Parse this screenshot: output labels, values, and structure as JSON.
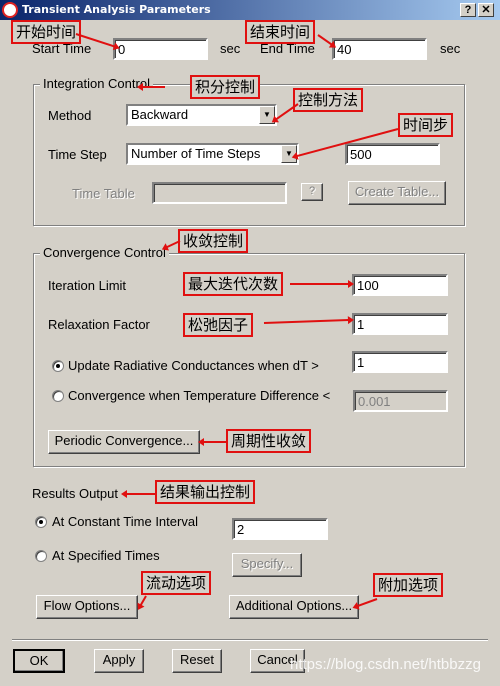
{
  "window": {
    "title": "Transient Analysis Parameters",
    "help_button": "?",
    "close_button": "✕"
  },
  "time_range": {
    "start_label": "Start Time",
    "start_value": "0",
    "start_unit": "sec",
    "end_label": "End Time",
    "end_value": "40",
    "end_unit": "sec"
  },
  "integration": {
    "group_label": "Integration Control",
    "method_label": "Method",
    "method_value": "Backward",
    "time_step_label": "Time Step",
    "time_step_mode": "Number of Time Steps",
    "time_step_value": "500",
    "time_table_label": "Time Table",
    "time_table_value": "",
    "time_table_help": "?",
    "create_table_label": "Create Table..."
  },
  "convergence": {
    "group_label": "Convergence Control",
    "iteration_limit_label": "Iteration Limit",
    "iteration_limit_value": "100",
    "relaxation_label": "Relaxation Factor",
    "relaxation_value": "1",
    "update_radiative_label": "Update Radiative Conductances when dT >",
    "update_radiative_value": "1",
    "update_radiative_checked": true,
    "temp_diff_label": "Convergence when Temperature Difference <",
    "temp_diff_value": "0.001",
    "temp_diff_checked": false,
    "periodic_button": "Periodic Convergence..."
  },
  "results": {
    "label": "Results Output",
    "constant_interval_label": "At Constant Time Interval",
    "constant_interval_value": "2",
    "constant_interval_checked": true,
    "specified_times_label": "At Specified Times",
    "specified_times_checked": false,
    "specify_button": "Specify..."
  },
  "options": {
    "flow_button": "Flow Options...",
    "additional_button": "Additional Options..."
  },
  "footer": {
    "ok": "OK",
    "apply": "Apply",
    "reset": "Reset",
    "cancel": "Cancel"
  },
  "annotations": {
    "start_time": "开始时间",
    "end_time": "结束时间",
    "integration": "积分控制",
    "method": "控制方法",
    "time_step": "时间步",
    "convergence": "收敛控制",
    "iteration_limit": "最大迭代次数",
    "relaxation": "松弛因子",
    "periodic": "周期性收敛",
    "results_output": "结果输出控制",
    "flow": "流动选项",
    "additional": "附加选项"
  },
  "watermark": "https://blog.csdn.net/htbbzzg",
  "colors": {
    "annotation_red": "#e01010",
    "dialog_gray": "#d4d0c8",
    "title_blue": "#0a246a"
  }
}
